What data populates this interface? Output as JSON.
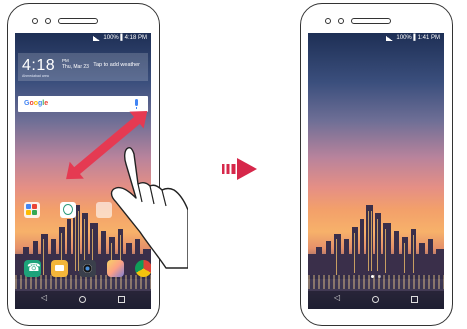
{
  "left_phone": {
    "status_text": "100% ▌4:18 PM",
    "clock": {
      "time": "4:18",
      "ampm": "PM",
      "date": "Thu, Mar 23",
      "weather_hint": "Tap to add weather",
      "sub": "Ahmedabad area"
    },
    "search": {
      "logo": "Google",
      "mic_icon": "mic-icon"
    },
    "icons": [
      "folder-icon",
      "contacts-icon",
      "phone-icon",
      "messages-icon",
      "camera-icon",
      "gallery-icon",
      "chrome-icon"
    ]
  },
  "right_phone": {
    "status_text": "100% ▌1:41 PM"
  },
  "gesture": {
    "hand_icon": "pinch-hand-icon",
    "arrow_color": "#e53a52"
  },
  "transition_arrow": {
    "icon": "right-arrow-icon",
    "color": "#d6274a"
  }
}
